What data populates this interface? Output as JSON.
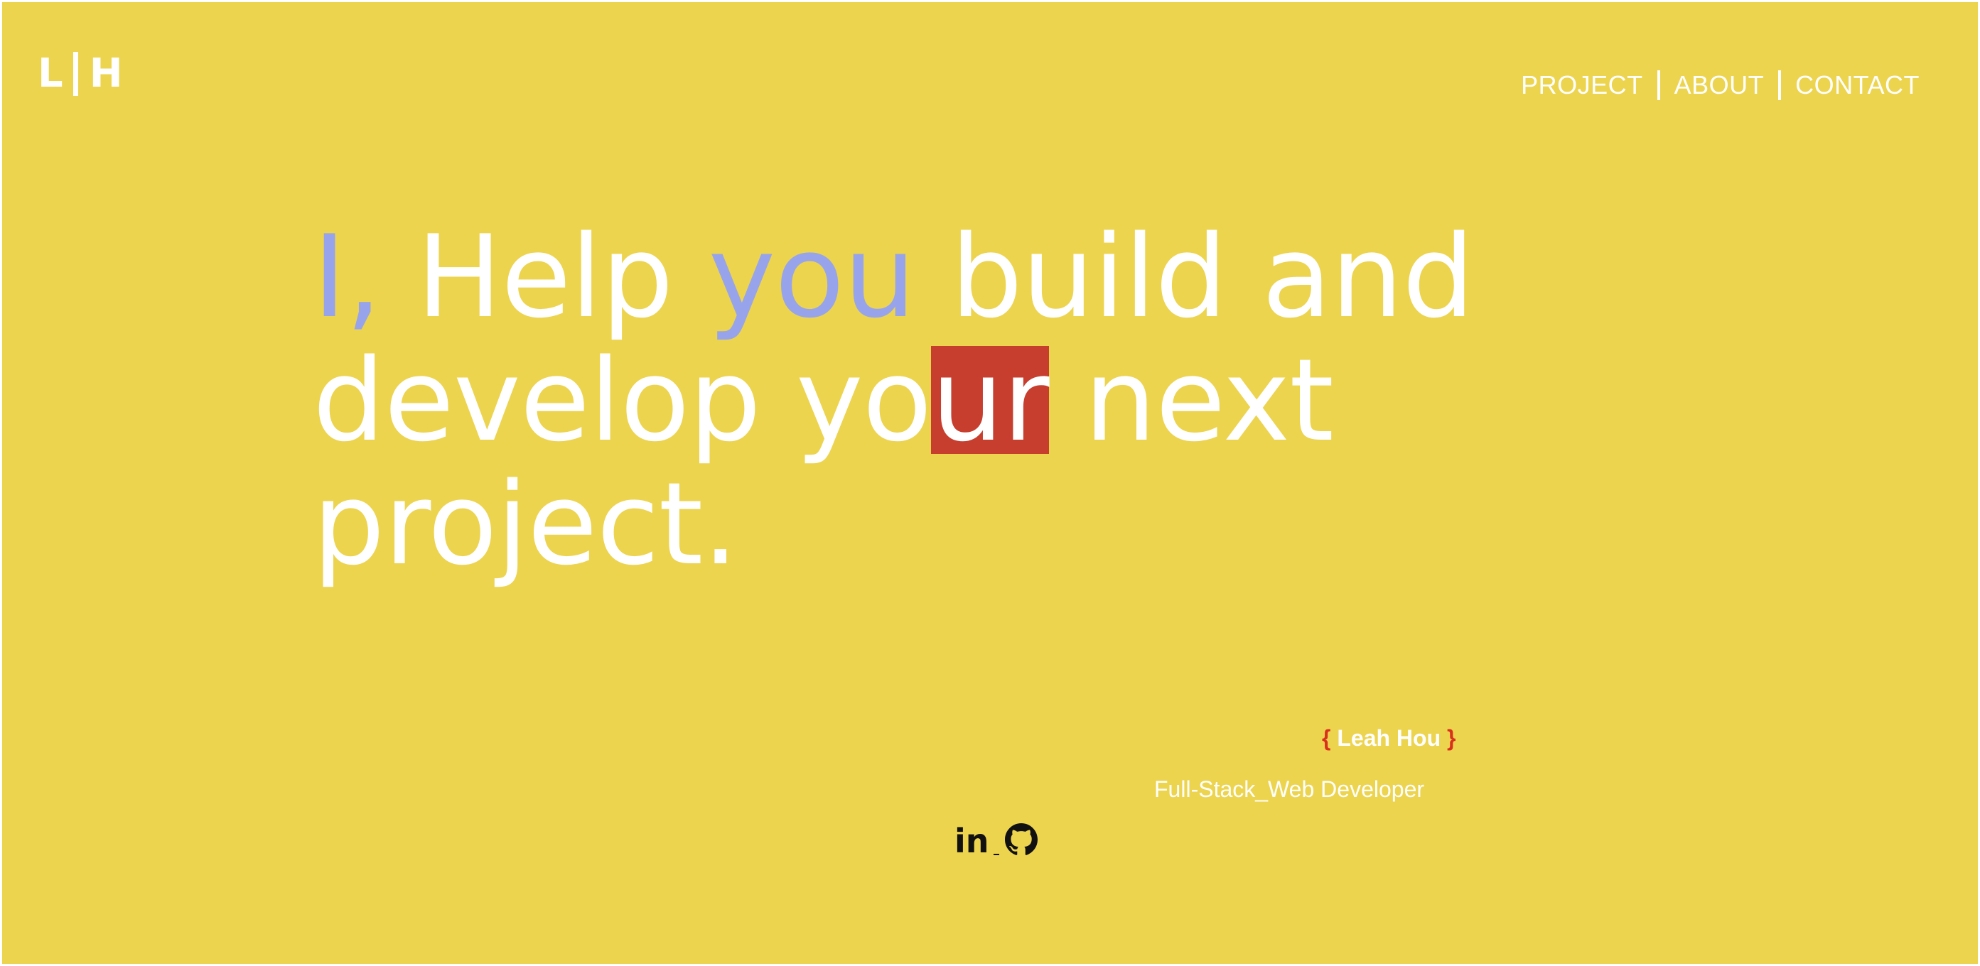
{
  "logo": {
    "left": "L",
    "right": "H"
  },
  "nav": {
    "items": [
      {
        "label": "PROJECT"
      },
      {
        "label": "ABOUT"
      },
      {
        "label": "CONTACT"
      }
    ]
  },
  "hero": {
    "line1": {
      "accent_start": "I,",
      "text_a": " Help ",
      "accent_mid": "you",
      "text_b": " build and"
    },
    "line2": {
      "text_a": "develop yo",
      "highlight": "ur",
      "text_b": " next"
    },
    "line3": {
      "text": "project."
    }
  },
  "profile": {
    "brace_open": "{",
    "name": " Leah Hou ",
    "brace_close": "}",
    "role": "Full-Stack_Web Developer"
  },
  "social": {
    "linkedin_label": "in",
    "github_icon": "github-icon"
  },
  "colors": {
    "background": "#EDD44E",
    "accent": "#97A4EC",
    "highlight": "#C73E2F",
    "brace": "#D9301E",
    "text": "#FFFFFF"
  }
}
